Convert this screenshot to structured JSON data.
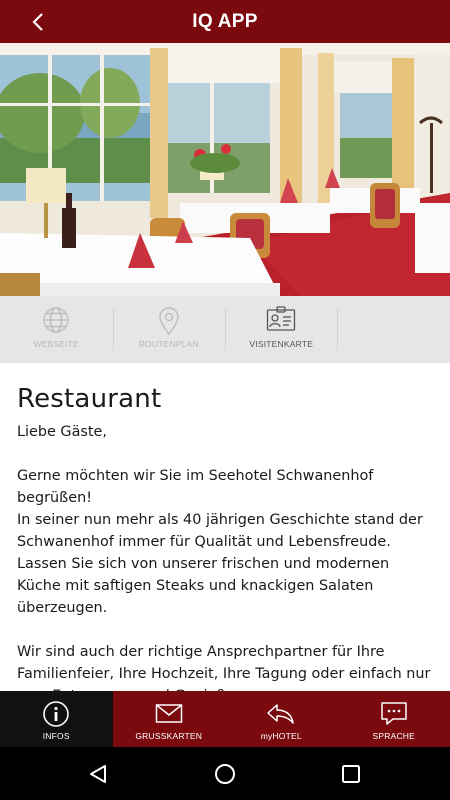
{
  "app_bar": {
    "title": "IQ APP",
    "back_icon": "chevron-left-icon"
  },
  "hero_image": {
    "description_icon": "restaurant-photo"
  },
  "actions": [
    {
      "label": "WEBSEITE",
      "icon": "globe-icon",
      "enabled": false
    },
    {
      "label": "ROUTENPLAN",
      "icon": "map-pin-icon",
      "enabled": false
    },
    {
      "label": "VISITENKARTE",
      "icon": "contact-card-icon",
      "enabled": true
    }
  ],
  "content": {
    "title": "Restaurant",
    "body": "Liebe Gäste,\n\nGerne möchten wir Sie im Seehotel Schwanenhof begrüßen!\nIn seiner nun mehr als 40 jährigen Geschichte stand der Schwanenhof immer für Qualität und Lebensfreude. Lassen Sie sich von unserer frischen und modernen Küche mit saftigen Steaks und knackigen Salaten überzeugen.\n\nWir sind auch der richtige Ansprechpartner für Ihre Familienfeier, Ihre Hochzeit, Ihre Tagung oder einfach nur zum Entspannen und Genießen."
  },
  "tabs": [
    {
      "label": "INFOS",
      "icon": "info-icon",
      "active": true
    },
    {
      "label": "GRUSSKARTEN",
      "icon": "envelope-icon",
      "active": false
    },
    {
      "label": "myHOTEL",
      "icon": "reply-arrow-icon",
      "active": false
    },
    {
      "label": "SPRACHE",
      "icon": "chat-bubble-icon",
      "active": false
    }
  ],
  "system_nav": {
    "back": "triangle-back-icon",
    "home": "circle-home-icon",
    "recents": "square-recents-icon"
  },
  "colors": {
    "brand": "#7b0a0f",
    "active_tab": "#111111",
    "action_bar": "#e6e6e6"
  }
}
